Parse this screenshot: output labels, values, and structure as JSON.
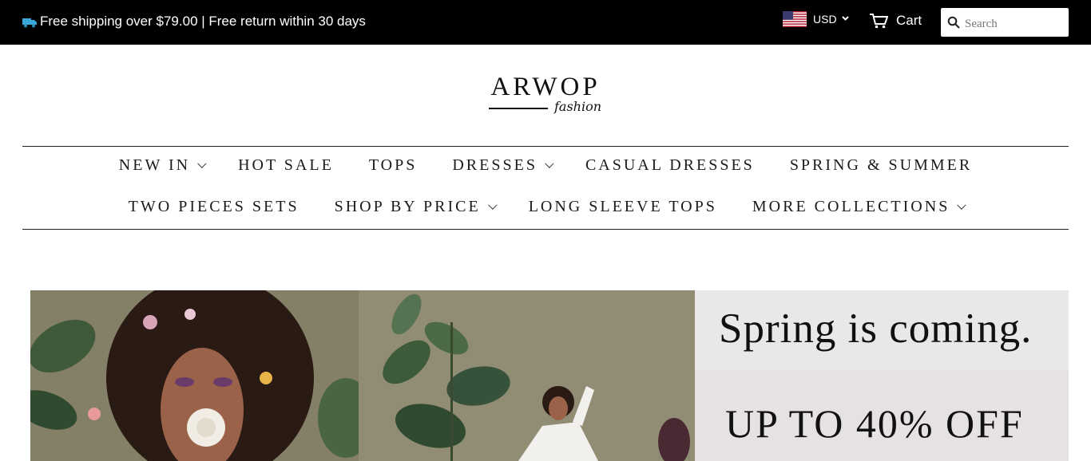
{
  "topbar": {
    "announcement": "Free shipping over $79.00 | Free return within 30 days",
    "truck_icon": "truck-icon",
    "currency": "USD",
    "flag_icon": "us-flag-icon",
    "cart_label": "Cart",
    "cart_icon": "cart-icon",
    "search_placeholder": "Search",
    "search_icon": "search-icon"
  },
  "logo": {
    "name": "ARWOP",
    "tagline": "fashion"
  },
  "nav": {
    "row1": [
      {
        "label": "NEW IN",
        "dropdown": true
      },
      {
        "label": "HOT SALE",
        "dropdown": false
      },
      {
        "label": "TOPS",
        "dropdown": false
      },
      {
        "label": "DRESSES",
        "dropdown": true
      },
      {
        "label": "CASUAL DRESSES",
        "dropdown": false
      },
      {
        "label": "SPRING & SUMMER",
        "dropdown": false
      }
    ],
    "row2": [
      {
        "label": "TWO PIECES SETS",
        "dropdown": false
      },
      {
        "label": "SHOP BY PRICE",
        "dropdown": true
      },
      {
        "label": "LONG SLEEVE TOPS",
        "dropdown": false
      },
      {
        "label": "MORE COLLECTIONS",
        "dropdown": true
      }
    ]
  },
  "hero": {
    "headline": "Spring is coming.",
    "offer": "UP TO 40% OFF"
  },
  "colors": {
    "topbar_bg": "#000000",
    "accent_truck": "#3aa7d8",
    "promo_bg": "#e6e2e3"
  }
}
